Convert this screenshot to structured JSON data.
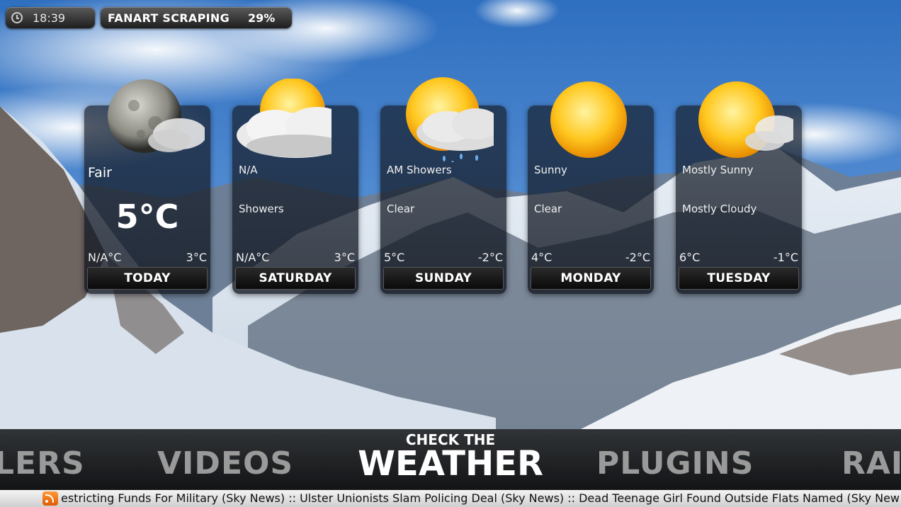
{
  "status": {
    "time": "18:39",
    "task_label": "FANART SCRAPING",
    "task_progress": "29%"
  },
  "forecast": [
    {
      "icon": "moon-cloud-icon",
      "condition": "Fair",
      "current_temp": "5°C",
      "low": "N/A°C",
      "high": "3°C",
      "day": "TODAY"
    },
    {
      "icon": "sun-cloud-icon",
      "line1": "N/A",
      "line2": "Showers",
      "low": "N/A°C",
      "high": "3°C",
      "day": "SATURDAY"
    },
    {
      "icon": "sun-rain-cloud-icon",
      "line1": "AM Showers",
      "line2": "Clear",
      "low": "5°C",
      "high": "-2°C",
      "day": "SUNDAY"
    },
    {
      "icon": "sun-icon",
      "line1": "Sunny",
      "line2": "Clear",
      "low": "4°C",
      "high": "-2°C",
      "day": "MONDAY"
    },
    {
      "icon": "sun-small-cloud-icon",
      "line1": "Mostly Sunny",
      "line2": "Mostly Cloudy",
      "low": "6°C",
      "high": "-1°C",
      "day": "TUESDAY"
    }
  ],
  "menu": {
    "left_partial": "LERS",
    "prev": "VIDEOS",
    "selected_sub": "CHECK THE",
    "selected": "WEATHER",
    "next": "PLUGINS",
    "right_partial": "RAI"
  },
  "ticker": {
    "text": "estricting Funds For Military (Sky News) :: Ulster Unionists Slam Policing Deal (Sky News) :: Dead Teenage Girl Found Outside Flats Named (Sky New"
  }
}
